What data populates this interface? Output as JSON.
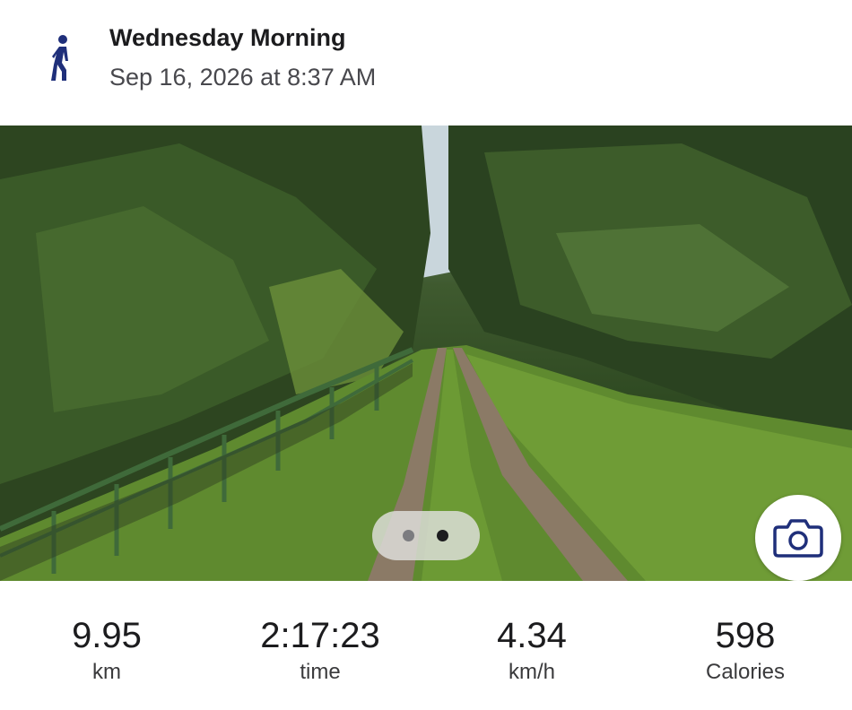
{
  "activity": {
    "icon": "walking-person-icon",
    "title": "Wednesday Morning",
    "datetime": "Sep 16, 2026 at 8:37 AM"
  },
  "photo": {
    "page_count": 2,
    "current_page": 2,
    "camera_icon": "camera-icon"
  },
  "stats": [
    {
      "value": "9.95",
      "unit": "km"
    },
    {
      "value": "2:17:23",
      "unit": "time"
    },
    {
      "value": "4.34",
      "unit": "km/h"
    },
    {
      "value": "598",
      "unit": "Calories"
    }
  ],
  "colors": {
    "accent": "#1f2f7a",
    "text": "#1c1c1e",
    "secondary_text": "#48484d"
  }
}
